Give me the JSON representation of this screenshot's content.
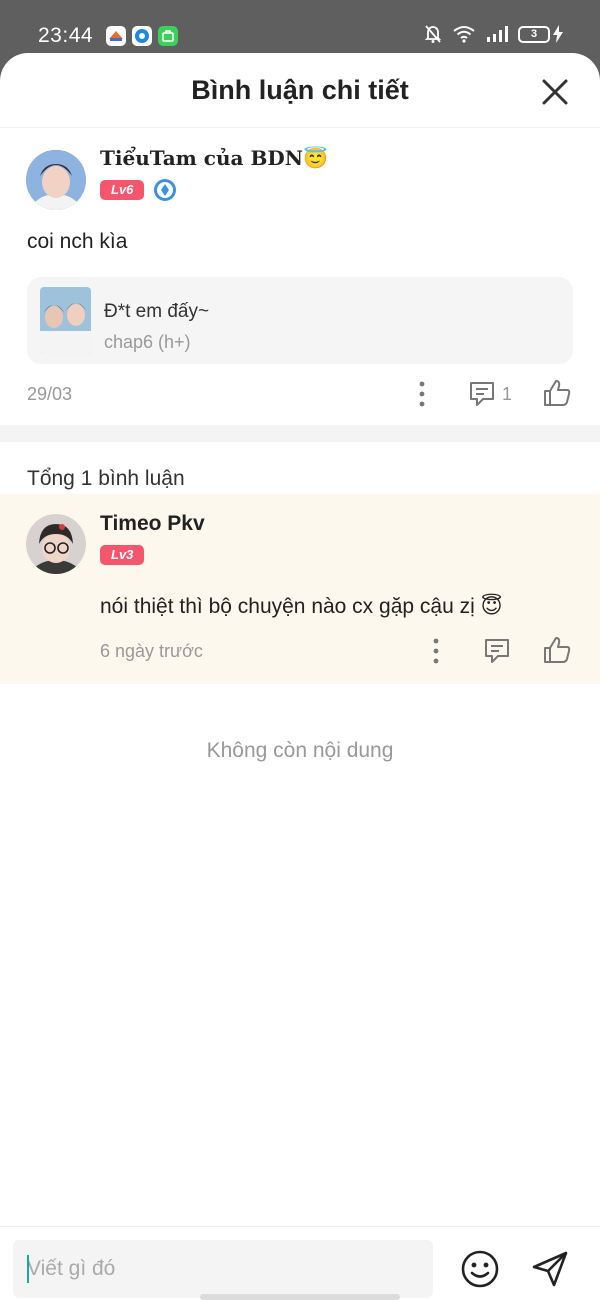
{
  "status_bar": {
    "time": "23:44",
    "battery": "3"
  },
  "header": {
    "title": "Bình luận chi tiết"
  },
  "post": {
    "username": "TiểuTam của BDN😇",
    "level": "Lv6",
    "text": "coi nch kìa",
    "quote": {
      "title": "Đ*t em đấy~",
      "subtitle": "chap6 (h+)"
    },
    "date": "29/03",
    "reply_count": "1"
  },
  "total_label": "Tổng 1 bình luận",
  "comments": [
    {
      "username": "Timeo Pkv",
      "level": "Lv3",
      "text": "nói thiệt thì bộ chuyện nào cx gặp cậu zị 😇",
      "time": "6 ngày trước"
    }
  ],
  "empty_label": "Không còn nội dung",
  "composer": {
    "placeholder": "Viết gì đó"
  },
  "colors": {
    "badge": "#f4566d",
    "comment_bg": "#fdf8ee",
    "accent": "#1aa7a0"
  },
  "icons": [
    "close-icon",
    "more-icon",
    "reply-icon",
    "like-icon",
    "emoji-icon",
    "send-icon",
    "vip-icon"
  ]
}
